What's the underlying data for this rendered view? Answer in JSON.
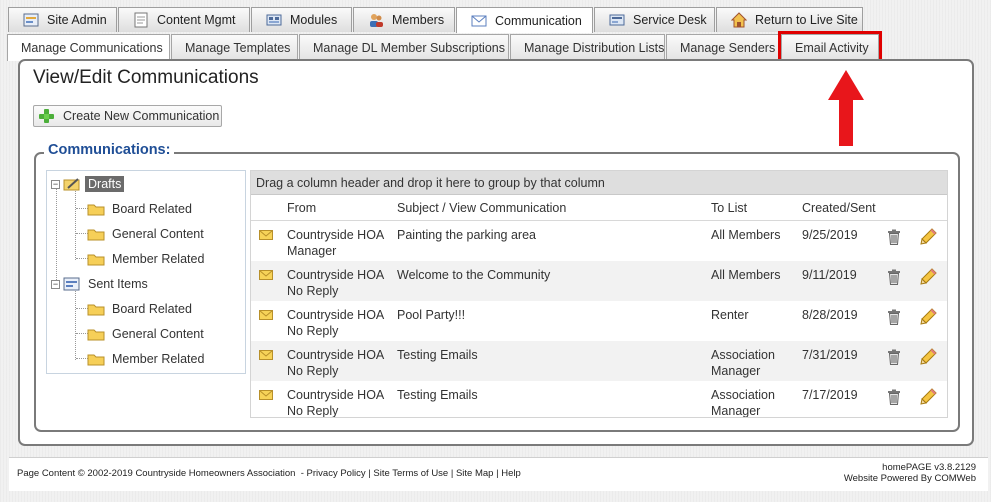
{
  "top_tabs": [
    {
      "label": "Site Admin",
      "icon": "site-admin-icon"
    },
    {
      "label": "Content Mgmt",
      "icon": "content-mgmt-icon"
    },
    {
      "label": "Modules",
      "icon": "modules-icon"
    },
    {
      "label": "Members",
      "icon": "members-icon"
    },
    {
      "label": "Communication",
      "icon": "envelope-icon",
      "active": true
    },
    {
      "label": "Service Desk",
      "icon": "service-desk-icon"
    },
    {
      "label": "Return to Live Site",
      "icon": "home-icon"
    }
  ],
  "sub_tabs": [
    {
      "label": "Manage Communications",
      "active": true
    },
    {
      "label": "Manage Templates"
    },
    {
      "label": "Manage DL Member Subscriptions"
    },
    {
      "label": "Manage Distribution Lists"
    },
    {
      "label": "Manage Senders"
    },
    {
      "label": "Email Activity",
      "highlighted": true
    }
  ],
  "page": {
    "title": "View/Edit Communications",
    "create_button": "Create New Communication",
    "legend": "Communications:"
  },
  "tree": {
    "drafts": "Drafts",
    "drafts_children": [
      "Board Related",
      "General Content",
      "Member Related"
    ],
    "sent": "Sent Items",
    "sent_children": [
      "Board Related",
      "General Content",
      "Member Related"
    ]
  },
  "grid": {
    "group_hint": "Drag a column header and drop it here to group by that column",
    "columns": [
      "From",
      "Subject / View Communication",
      "To List",
      "Created/Sent"
    ],
    "rows": [
      {
        "from1": "Countryside HOA",
        "from2": "Manager",
        "subject": "Painting the parking area",
        "to1": "All Members",
        "to2": "",
        "date": "9/25/2019"
      },
      {
        "from1": "Countryside HOA",
        "from2": "No Reply",
        "subject": "Welcome to the Community",
        "to1": "All Members",
        "to2": "",
        "date": "9/11/2019"
      },
      {
        "from1": "Countryside HOA",
        "from2": "No Reply",
        "subject": "Pool Party!!!",
        "to1": "Renter",
        "to2": "",
        "date": "8/28/2019"
      },
      {
        "from1": "Countryside HOA",
        "from2": "No Reply",
        "subject": "Testing Emails",
        "to1": "Association",
        "to2": "Manager",
        "date": "7/31/2019"
      },
      {
        "from1": "Countryside HOA",
        "from2": "No Reply",
        "subject": "Testing Emails",
        "to1": "Association",
        "to2": "Manager",
        "date": "7/17/2019"
      }
    ]
  },
  "footer": {
    "copyright": "Page Content © 2002-2019 Countryside Homeowners Association",
    "privacy": "Privacy Policy",
    "terms": "Site Terms of Use",
    "sitemap": "Site Map",
    "help": "Help",
    "version": "homePAGE v3.8.2129",
    "powered": "Website Powered By COMWeb"
  },
  "colors": {
    "highlight": "#e00000",
    "legend": "#1f4e96",
    "selected_node": "#6b6b6b"
  }
}
